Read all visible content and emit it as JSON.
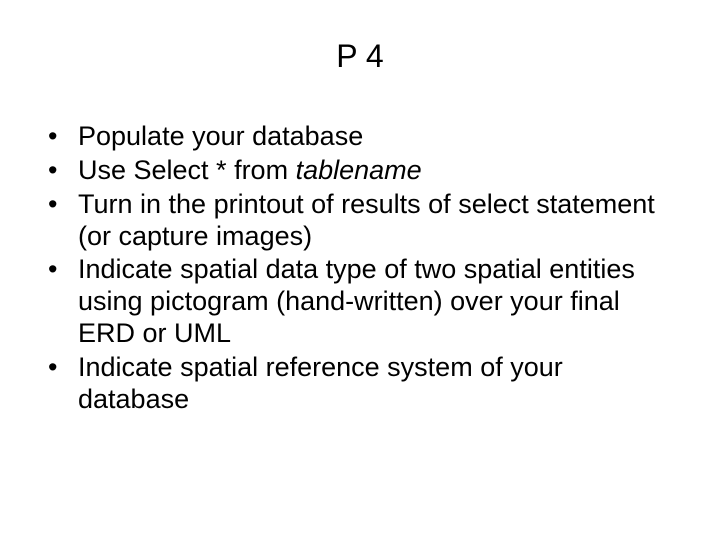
{
  "title": "P 4",
  "bullets": [
    {
      "pre": "Populate your database",
      "italic": "",
      "post": ""
    },
    {
      "pre": "Use Select * from ",
      "italic": "tablename",
      "post": ""
    },
    {
      "pre": "Turn in the printout of results of select statement (or capture images)",
      "italic": "",
      "post": ""
    },
    {
      "pre": "Indicate spatial data type of two spatial entities using pictogram (hand-written) over your final ERD or UML",
      "italic": "",
      "post": ""
    },
    {
      "pre": "Indicate spatial reference system of your database",
      "italic": "",
      "post": ""
    }
  ]
}
